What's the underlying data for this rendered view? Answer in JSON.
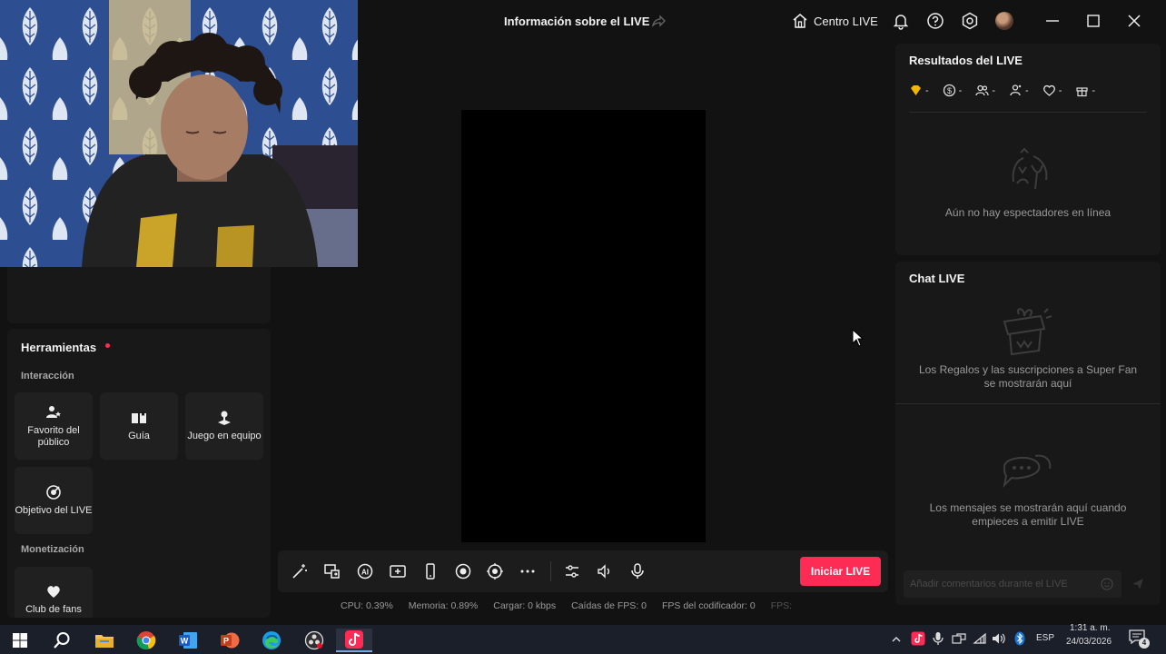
{
  "window": {
    "title": "Información sobre el LIVE",
    "centro_label": "Centro LIVE"
  },
  "tools": {
    "title": "Herramientas",
    "interaction_label": "Interacción",
    "monetization_label": "Monetización",
    "items": [
      {
        "label": "Favorito del público",
        "icon": "audience-favorite-icon"
      },
      {
        "label": "Guía",
        "icon": "guide-icon"
      },
      {
        "label": "Juego en equipo",
        "icon": "team-game-icon"
      },
      {
        "label": "Objetivo del LIVE",
        "icon": "live-goal-icon"
      }
    ],
    "monetization_items": [
      {
        "label": "Club de fans",
        "icon": "fan-club-icon"
      }
    ]
  },
  "controls": {
    "icons": [
      "magic-wand-icon",
      "screen-share-icon",
      "ai-effect-icon",
      "add-source-icon",
      "phone-icon",
      "record-icon",
      "camera-focus-icon",
      "more-icon",
      "settings-sliders-icon",
      "volume-icon",
      "microphone-icon"
    ],
    "start_label": "Iniciar LIVE"
  },
  "stats": {
    "cpu": "CPU: 0.39%",
    "memory": "Memoria: 0.89%",
    "upload": "Cargar: 0 kbps",
    "fps_drops": "Caídas de FPS: 0",
    "encoder_fps": "FPS del codificador: 0",
    "fps": "FPS:"
  },
  "results": {
    "title": "Resultados del LIVE",
    "metrics": [
      {
        "icon": "diamond-icon",
        "value": "-"
      },
      {
        "icon": "coin-icon",
        "value": "-"
      },
      {
        "icon": "viewers-icon",
        "value": "-"
      },
      {
        "icon": "new-followers-icon",
        "value": "-"
      },
      {
        "icon": "heart-icon",
        "value": "-"
      },
      {
        "icon": "gift-icon",
        "value": "-"
      }
    ],
    "empty_text": "Aún no hay espectadores en línea"
  },
  "chat": {
    "title": "Chat LIVE",
    "gifts_text": "Los Regalos y las suscripciones a Super Fan se mostrarán aquí",
    "messages_text": "Los mensajes se mostrarán aquí cuando empieces a emitir LIVE",
    "input_placeholder": "Añadir comentarios durante el LIVE"
  },
  "taskbar": {
    "apps": [
      "windows-start-icon",
      "search-icon",
      "file-explorer-icon",
      "chrome-icon",
      "word-icon",
      "powerpoint-icon",
      "edge-icon",
      "obs-icon",
      "tiktok-live-studio-icon"
    ],
    "language": "ESP",
    "time": "1:31 a. m.",
    "date": "24/03/2026",
    "notification_count": "4"
  },
  "colors": {
    "accent": "#fe2c55",
    "background": "#121212",
    "panel": "#181818"
  }
}
